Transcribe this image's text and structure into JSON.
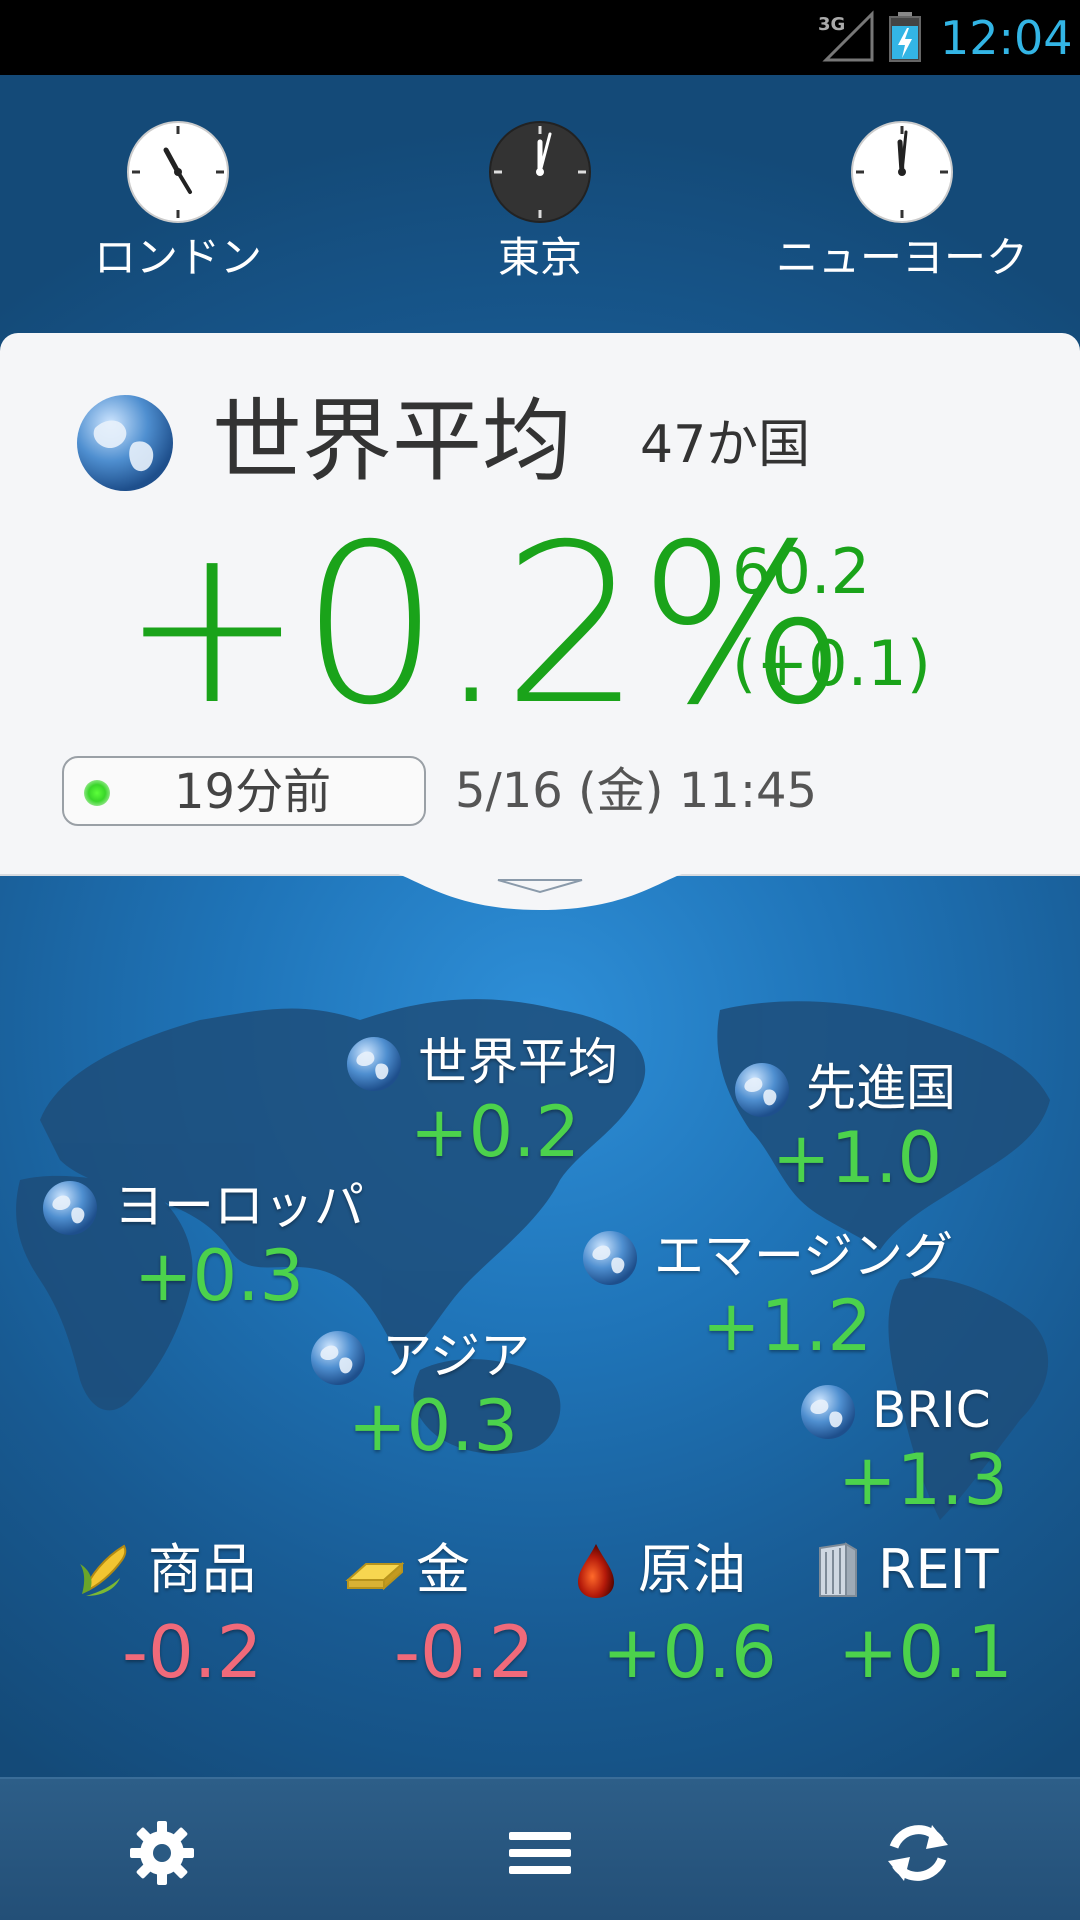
{
  "status": {
    "network": "3G",
    "time": "12:04"
  },
  "clocks": [
    {
      "label": "ロンドン",
      "hour": 4,
      "minute": 55,
      "dark": false
    },
    {
      "label": "東京",
      "hour": 12,
      "minute": 4,
      "dark": true
    },
    {
      "label": "ニューヨーク",
      "hour": 11,
      "minute": 56,
      "dark": false
    }
  ],
  "card": {
    "title": "世界平均",
    "count": "47か国",
    "change_pct": "+0.2%",
    "value": "60.2",
    "change": "(+0.1)",
    "ago": "19分前",
    "timestamp": "5/16 (金) 11:45"
  },
  "regions": [
    {
      "name": "世界平均",
      "value": "+0.2"
    },
    {
      "name": "先進国",
      "value": "+1.0"
    },
    {
      "name": "ヨーロッパ",
      "value": "+0.3"
    },
    {
      "name": "エマージング",
      "value": "+1.2"
    },
    {
      "name": "アジア",
      "value": "+0.3"
    },
    {
      "name": "BRIC",
      "value": "+1.3"
    }
  ],
  "commodities": [
    {
      "name": "商品",
      "value": "-0.2",
      "icon": "corn-icon",
      "color": "#f06a7a"
    },
    {
      "name": "金",
      "value": "-0.2",
      "icon": "gold-bar-icon",
      "color": "#f06a7a"
    },
    {
      "name": "原油",
      "value": "+0.6",
      "icon": "oil-drop-icon",
      "color": "#4cd24c"
    },
    {
      "name": "REIT",
      "value": "+0.1",
      "icon": "building-icon",
      "color": "#4cd24c"
    }
  ],
  "colors": {
    "positive": "#1aa31a",
    "positive_map": "#4cd24c",
    "negative": "#f06a7a",
    "clock_text": "#33b5e5"
  },
  "toolbar": {
    "settings_icon": "gear-icon",
    "menu_icon": "menu-icon",
    "refresh_icon": "refresh-icon"
  }
}
